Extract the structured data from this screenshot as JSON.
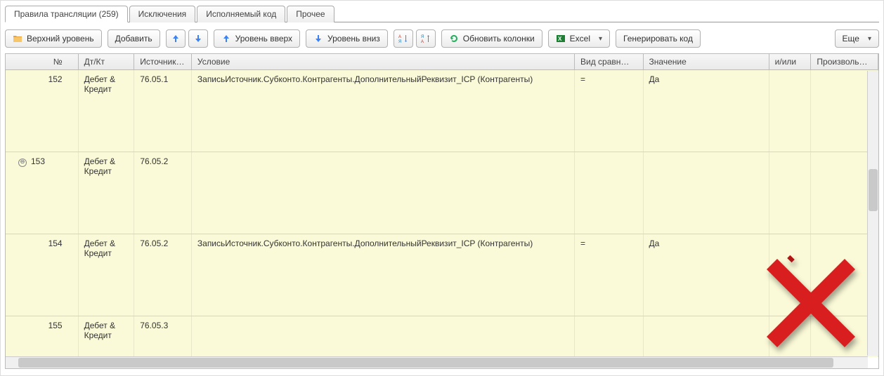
{
  "tabs": [
    {
      "label": "Правила трансляции (259)",
      "active": true
    },
    {
      "label": "Исключения",
      "active": false
    },
    {
      "label": "Исполняемый код",
      "active": false
    },
    {
      "label": "Прочее",
      "active": false
    }
  ],
  "toolbar": {
    "top_level": "Верхний уровень",
    "add": "Добавить",
    "level_up": "Уровень вверх",
    "level_down": "Уровень вниз",
    "update_cols": "Обновить колонки",
    "excel": "Excel",
    "gen_code": "Генерировать код",
    "more": "Еще"
  },
  "columns": {
    "no": "№",
    "dtkt": "Дт/Кт",
    "src": "Источник…",
    "usl": "Условие",
    "cmp": "Вид сравн…",
    "val": "Значение",
    "andor": "и/или",
    "arb": "Произвольное"
  },
  "rows": [
    {
      "no": "152",
      "dtkt": "Дебет & Кредит",
      "src": "76.05.1",
      "usl": "ЗаписьИсточник.Субконто.Контрагенты.ДополнительныйРеквизит_ICP (Контрагенты)",
      "cmp": "=",
      "val": "Да",
      "expand": ""
    },
    {
      "no": "153",
      "dtkt": "Дебет & Кредит",
      "src": "76.05.2",
      "usl": "",
      "cmp": "",
      "val": "",
      "expand": "⊖"
    },
    {
      "no": "154",
      "dtkt": "Дебет & Кредит",
      "src": "76.05.2",
      "usl": "ЗаписьИсточник.Субконто.Контрагенты.ДополнительныйРеквизит_ICP (Контрагенты)",
      "cmp": "=",
      "val": "Да",
      "expand": ""
    },
    {
      "no": "155",
      "dtkt": "Дебет & Кредит",
      "src": "76.05.3",
      "usl": "",
      "cmp": "",
      "val": "",
      "expand": ""
    }
  ],
  "icons": {
    "folder": "folder-icon",
    "arrow_up": "arrow-up-icon",
    "arrow_down": "arrow-down-icon",
    "level_up": "level-up-icon",
    "level_down": "level-down-icon",
    "sort_az": "sort-az-icon",
    "sort_za": "sort-za-icon",
    "refresh": "refresh-icon",
    "excel": "excel-icon"
  },
  "overlay": {
    "big_x": true
  }
}
